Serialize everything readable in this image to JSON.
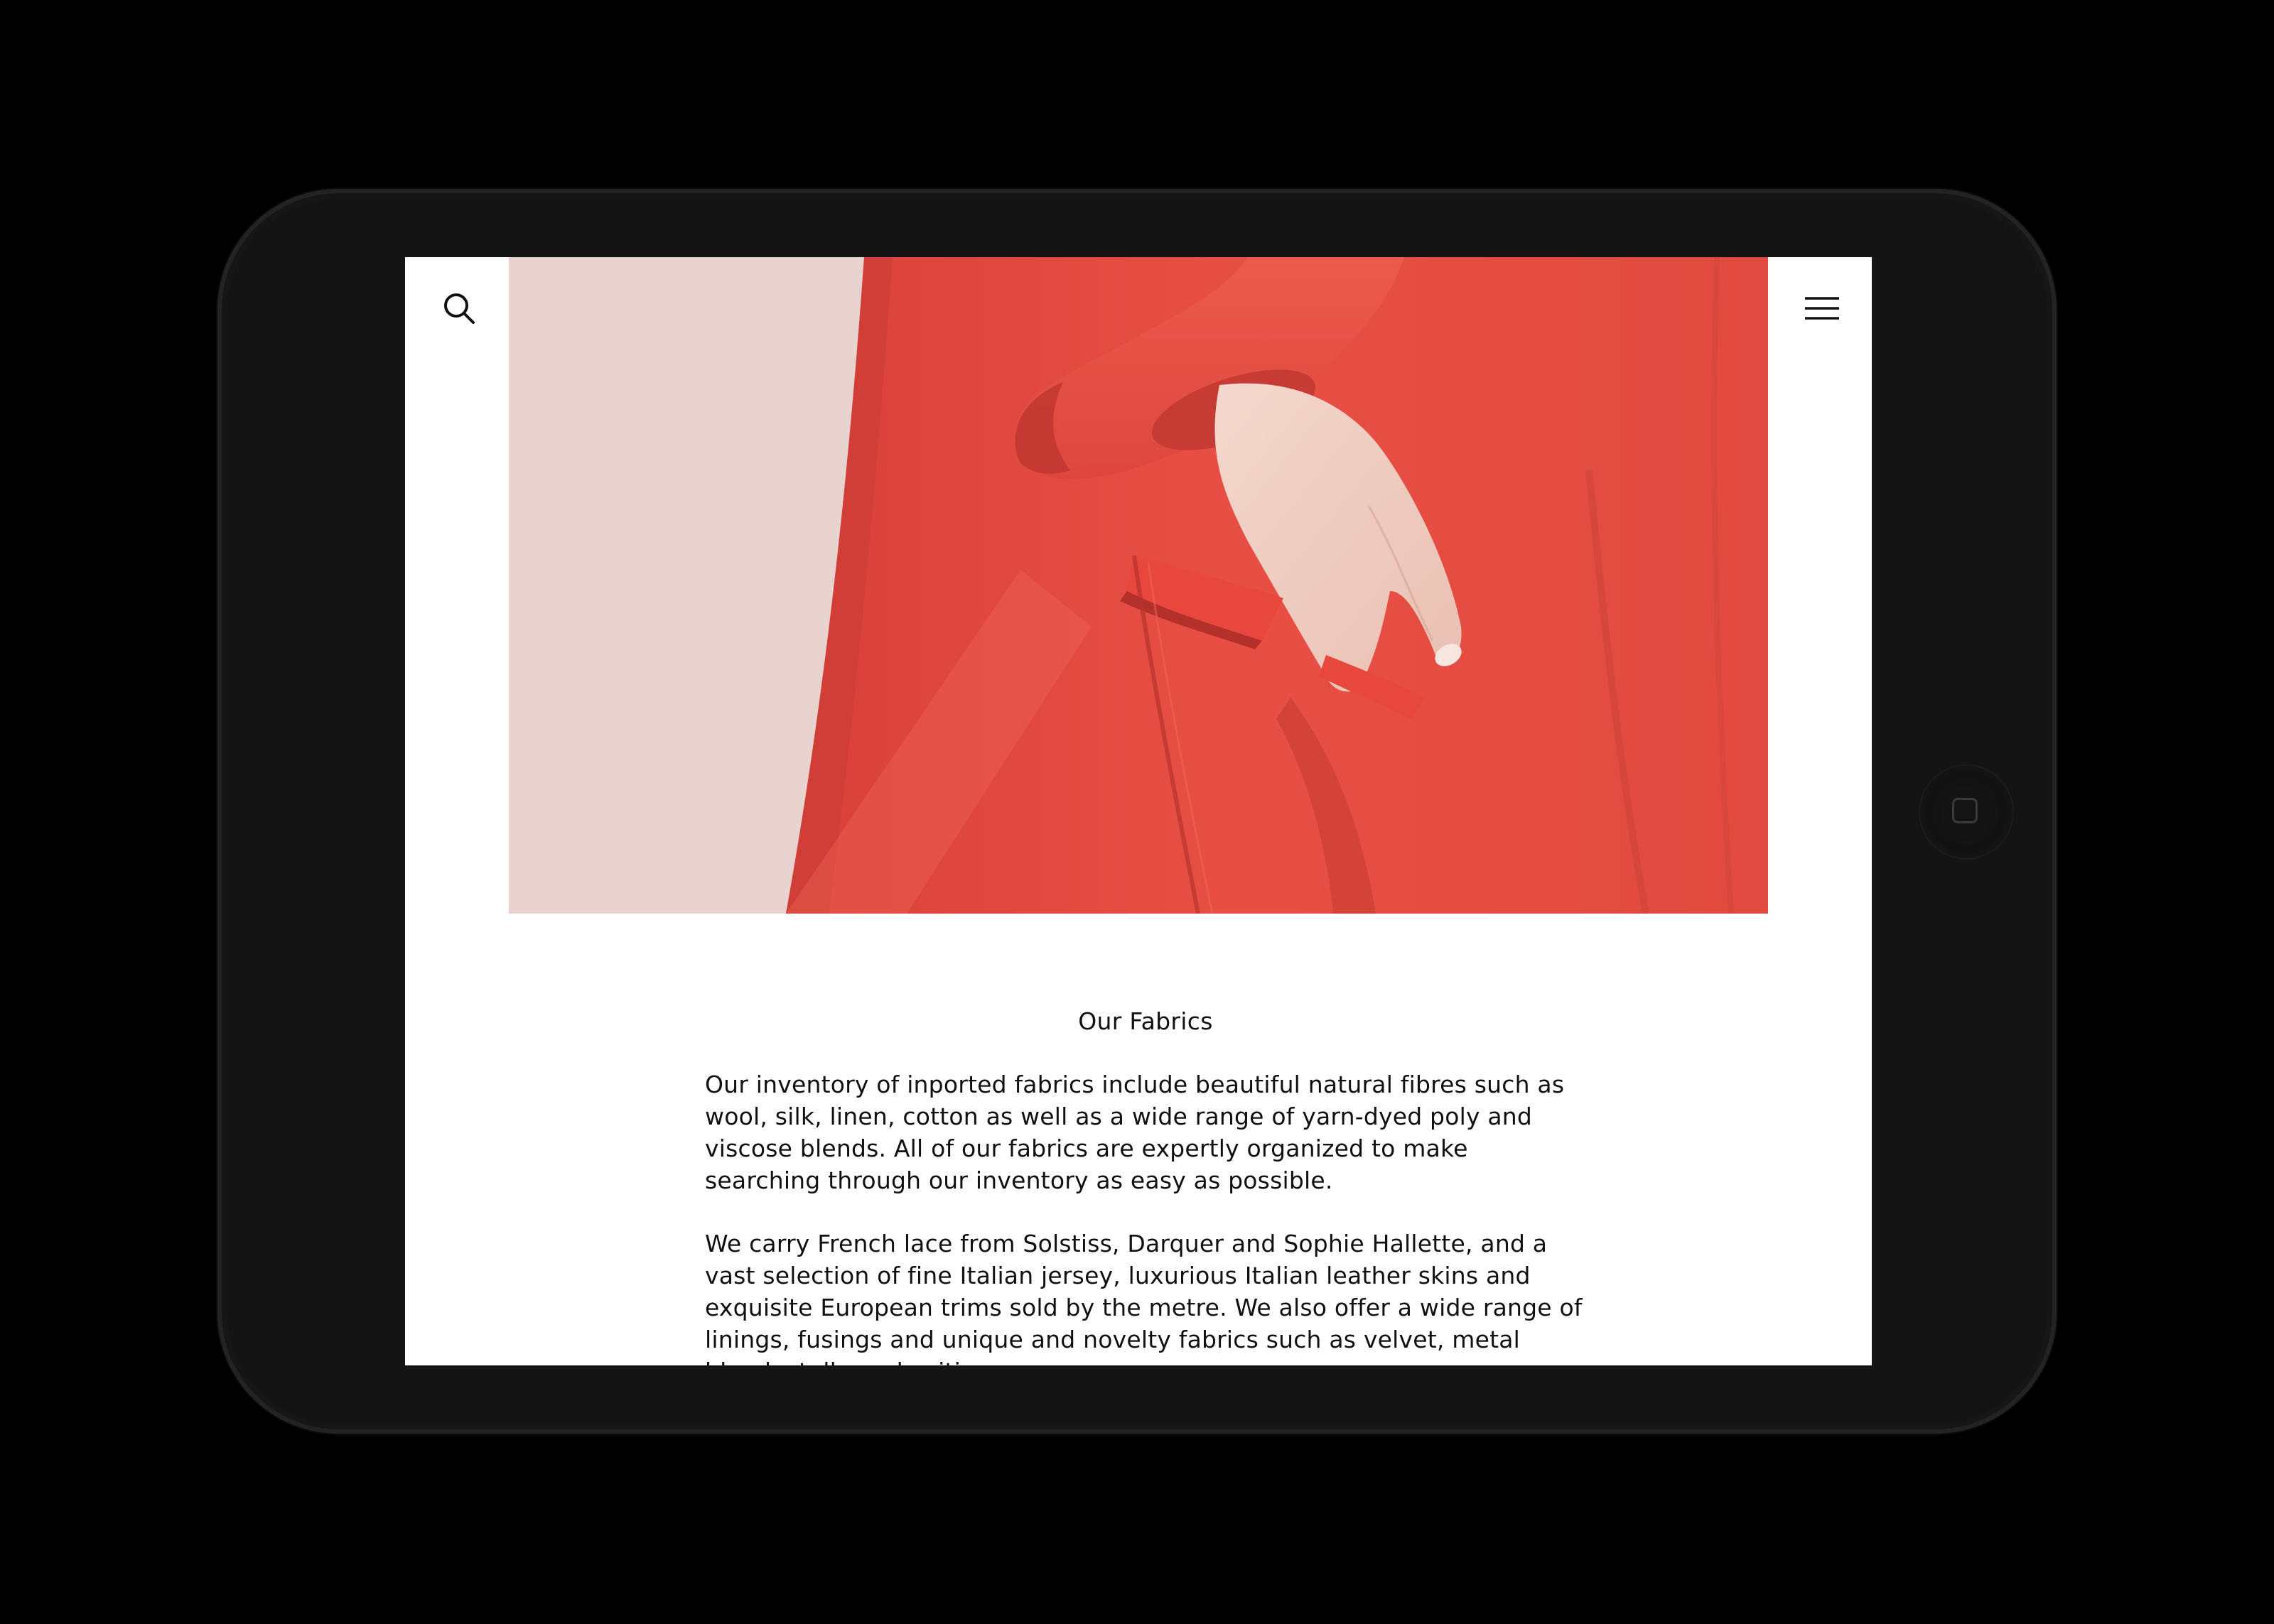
{
  "page": {
    "heading": "Our Fabrics",
    "paragraphs": [
      "Our inventory of inported fabrics include beautiful natural fibres such as wool, silk, linen, cotton as well as a wide range of yarn-dyed poly and viscose blends. All of our fabrics are expertly organized to make searching through our inventory as easy as possible.",
      "We carry French lace from Solstiss, Darquer and Sophie Hallette, and a vast selection of fine Italian jersey, luxurious Italian leather skins and exquisite European trims sold by the metre. We also offer a wide range of linings, fusings and unique and novelty fabrics such as velvet, metal blends, tulle and suiting."
    ]
  },
  "header": {
    "search_icon": "search-icon",
    "menu_icon": "hamburger-menu-icon"
  },
  "hero": {
    "image_description_icon": "red-coat-photo",
    "colors": {
      "background": "#e8d3cf",
      "coat": "#e2483f",
      "coat_shadow": "#c53a33",
      "coat_highlight": "#f05a4e",
      "skin": "#f1cfc4"
    }
  },
  "device": {
    "frame_color": "#141414",
    "home_button_icon": "home-button"
  }
}
